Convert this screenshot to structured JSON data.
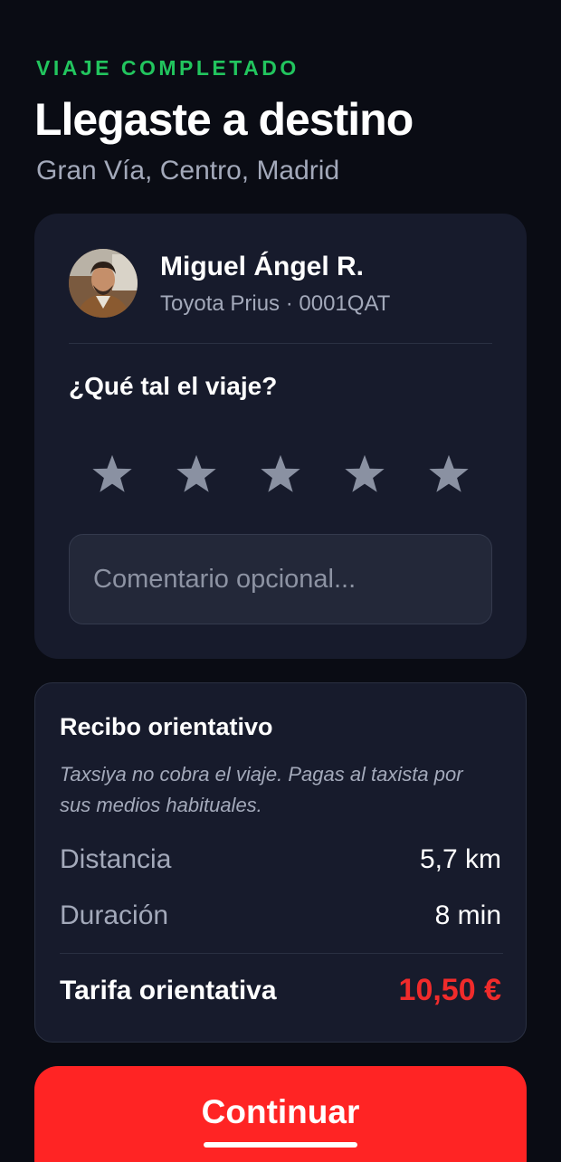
{
  "header": {
    "status_label": "VIAJE COMPLETADO",
    "title": "Llegaste a destino",
    "subtitle": "Gran Vía, Centro, Madrid"
  },
  "driver": {
    "name": "Miguel Ángel R.",
    "vehicle": "Toyota Prius · 0001QAT"
  },
  "rating": {
    "question": "¿Qué tal el viaje?",
    "max_stars": 5,
    "selected_stars": 0,
    "comment_placeholder": "Comentario opcional...",
    "comment_value": ""
  },
  "receipt": {
    "title": "Recibo orientativo",
    "note": "Taxsiya no cobra el viaje. Pagas al taxista por sus medios habituales.",
    "rows": [
      {
        "label": "Distancia",
        "value": "5,7 km"
      },
      {
        "label": "Duración",
        "value": "8 min"
      }
    ],
    "fare_label": "Tarifa orientativa",
    "fare_value": "10,50 €"
  },
  "actions": {
    "continue_label": "Continuar"
  },
  "colors": {
    "background": "#0a0c14",
    "card": "#171b2c",
    "accent_green": "#22c55e",
    "accent_red": "#ff2424",
    "star_inactive": "#8a91a2"
  },
  "icons": {
    "rating_star": "star-icon"
  }
}
